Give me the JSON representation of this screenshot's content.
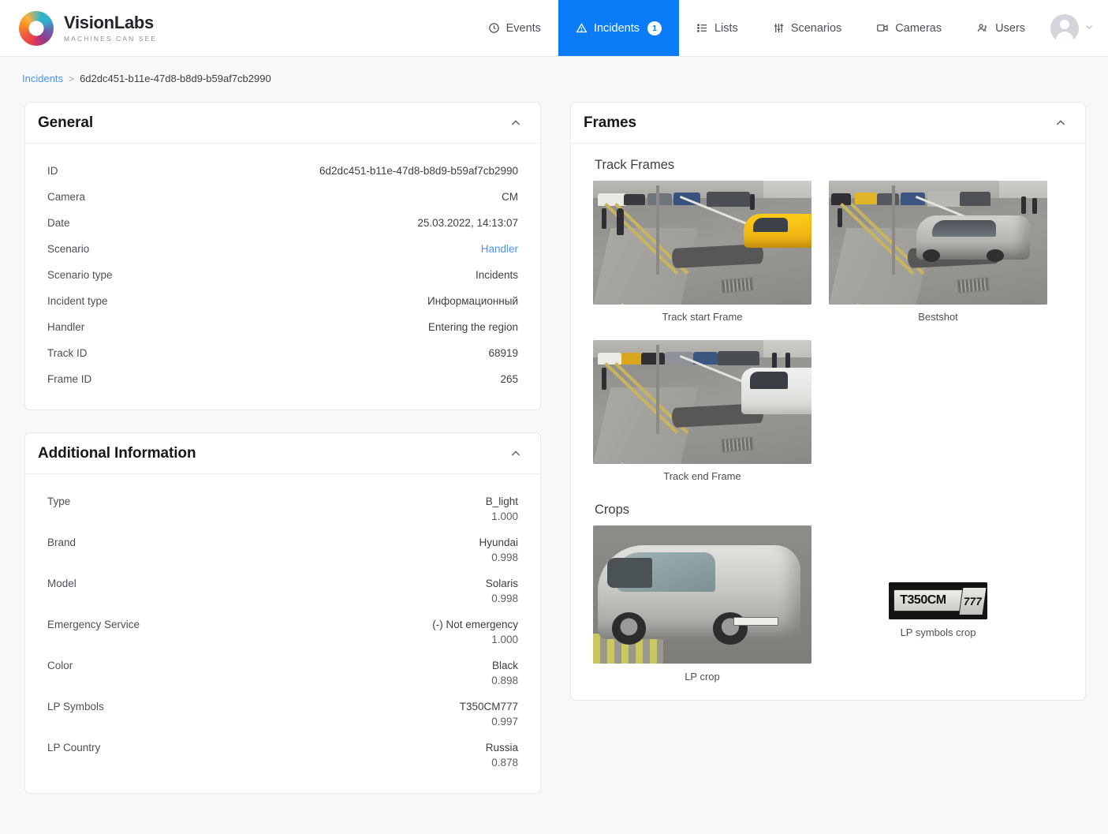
{
  "brand": {
    "name": "VisionLabs",
    "tagline": "MACHINES CAN SEE"
  },
  "nav": {
    "items": [
      {
        "label": "Events",
        "icon": "clock-icon",
        "active": false,
        "badge": null
      },
      {
        "label": "Incidents",
        "icon": "warning-triangle-icon",
        "active": true,
        "badge": "1"
      },
      {
        "label": "Lists",
        "icon": "list-icon",
        "active": false,
        "badge": null
      },
      {
        "label": "Scenarios",
        "icon": "sliders-icon",
        "active": false,
        "badge": null
      },
      {
        "label": "Cameras",
        "icon": "video-camera-icon",
        "active": false,
        "badge": null
      },
      {
        "label": "Users",
        "icon": "users-icon",
        "active": false,
        "badge": null
      }
    ],
    "accent_color": "#0a7cf7"
  },
  "breadcrumb": {
    "root": "Incidents",
    "separator": ">",
    "current": "6d2dc451-b11e-47d8-b8d9-b59af7cb2990"
  },
  "general": {
    "title": "General",
    "collapse_icon": "chevron-up-icon",
    "rows": [
      {
        "key": "ID",
        "value": "6d2dc451-b11e-47d8-b8d9-b59af7cb2990",
        "link": false
      },
      {
        "key": "Camera",
        "value": "CM",
        "link": false
      },
      {
        "key": "Date",
        "value": "25.03.2022, 14:13:07",
        "link": false
      },
      {
        "key": "Scenario",
        "value": "Handler",
        "link": true
      },
      {
        "key": "Scenario type",
        "value": "Incidents",
        "link": false
      },
      {
        "key": "Incident type",
        "value": "Информационный",
        "link": false
      },
      {
        "key": "Handler",
        "value": "Entering the region",
        "link": false
      },
      {
        "key": "Track ID",
        "value": "68919",
        "link": false
      },
      {
        "key": "Frame ID",
        "value": "265",
        "link": false
      }
    ]
  },
  "additional": {
    "title": "Additional Information",
    "collapse_icon": "chevron-up-icon",
    "rows": [
      {
        "key": "Type",
        "value": "B_light",
        "score": "1.000"
      },
      {
        "key": "Brand",
        "value": "Hyundai",
        "score": "0.998"
      },
      {
        "key": "Model",
        "value": "Solaris",
        "score": "0.998"
      },
      {
        "key": "Emergency Service",
        "value": "(-) Not emergency",
        "score": "1.000"
      },
      {
        "key": "Color",
        "value": "Black",
        "score": "0.898"
      },
      {
        "key": "LP Symbols",
        "value": "T350CM777",
        "score": "0.997"
      },
      {
        "key": "LP Country",
        "value": "Russia",
        "score": "0.878"
      }
    ]
  },
  "frames": {
    "title": "Frames",
    "collapse_icon": "chevron-up-icon",
    "track_frames_title": "Track Frames",
    "track_frames": [
      {
        "caption": "Track start Frame"
      },
      {
        "caption": "Bestshot"
      },
      {
        "caption": "Track end Frame"
      }
    ],
    "crops_title": "Crops",
    "crops": [
      {
        "caption": "LP crop"
      },
      {
        "caption": "LP symbols crop",
        "plate_text": "T350CM",
        "plate_region": "777"
      }
    ]
  }
}
